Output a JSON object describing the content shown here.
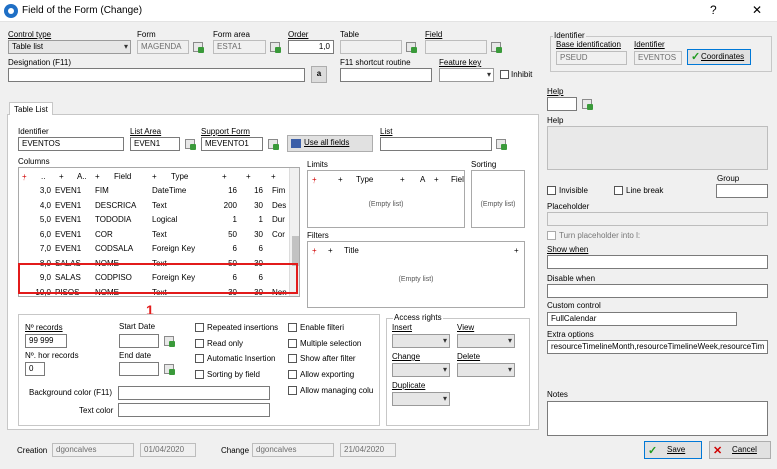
{
  "window": {
    "title": "Field of the Form (Change)",
    "help_glyph": "?",
    "close_glyph": "✕"
  },
  "top": {
    "control_type_label": "Control type",
    "control_type_value": "Table list",
    "form_label": "Form",
    "form_value": "MAGENDA",
    "form_area_label": "Form area",
    "form_area_value": "ESTA1",
    "order_label": "Order",
    "order_value": "1,0",
    "table_label": "Table",
    "field_label": "Field",
    "designation_label": "Designation (F11)",
    "designation_btn": "a",
    "f11_label": "F11 shortcut routine",
    "feature_key_label": "Feature key",
    "inhibit_label": "Inhibit"
  },
  "identifier_box": {
    "title": "Identifier",
    "base_label": "Base identification",
    "base_value": "PSEUD",
    "identifier_label": "Identifier",
    "identifier_value": "EVENTOS",
    "coordinates_btn": "Coordinates"
  },
  "tab": {
    "label": "Table List"
  },
  "table_list": {
    "identifier_label": "Identifier",
    "identifier_value": "EVENTOS",
    "list_area_label": "List Area",
    "list_area_value": "EVEN1",
    "support_form_label": "Support Form",
    "support_form_value": "MEVENTO1",
    "use_all_fields_btn": "Use all fields",
    "list_label": "List",
    "columns_label": "Columns",
    "columns_headers": [
      "..",
      "A..",
      "Field",
      "Type"
    ],
    "columns_rows": [
      [
        "3,0",
        "EVEN1",
        "FIM",
        "DateTime",
        "16",
        "16",
        "Fim"
      ],
      [
        "4,0",
        "EVEN1",
        "DESCRICA",
        "Text",
        "200",
        "30",
        "Des"
      ],
      [
        "5,0",
        "EVEN1",
        "TODODIA",
        "Logical",
        "1",
        "1",
        "Dur"
      ],
      [
        "6,0",
        "EVEN1",
        "COR",
        "Text",
        "50",
        "30",
        "Cor"
      ],
      [
        "7,0",
        "EVEN1",
        "CODSALA",
        "Foreign Key",
        "6",
        "6",
        ""
      ],
      [
        "8,0",
        "SALAS",
        "NOME",
        "Text",
        "50",
        "30",
        ""
      ],
      [
        "9,0",
        "SALAS",
        "CODPISO",
        "Foreign Key",
        "6",
        "6",
        ""
      ],
      [
        "10,0",
        "PISOS",
        "NOME",
        "Text",
        "30",
        "30",
        "Non"
      ]
    ],
    "highlight_label": "1",
    "limits_label": "Limits",
    "limits_headers": [
      "Type",
      "A",
      "Fiel"
    ],
    "limits_empty": "(Empty list)",
    "sorting_label": "Sorting",
    "sorting_empty": "(Empty list)",
    "filters_label": "Filters",
    "filters_headers": [
      "Title"
    ],
    "filters_empty": "(Empty list)"
  },
  "bottom": {
    "n_records_label": "Nº records",
    "n_records_value": "99 999",
    "n_hor_label": "Nº. hor records",
    "n_hor_value": "0",
    "start_date_label": "Start Date",
    "end_date_label": "End date",
    "checks_col1": [
      "Repeated insertions",
      "Read only",
      "Automatic Insertion",
      "Sorting by field"
    ],
    "checks_col2": [
      "Enable filteri",
      "Multiple selection",
      "Show after filter",
      "Allow exporting",
      "Allow managing colu"
    ],
    "bg_color_label": "Background color (F11)",
    "text_color_label": "Text color",
    "access_rights_label": "Access rights",
    "insert_label": "Insert",
    "view_label": "View",
    "change_label": "Change",
    "delete_label": "Delete",
    "duplicate_label": "Duplicate"
  },
  "right": {
    "help1_label": "Help",
    "help2_label": "Help",
    "invisible_label": "Invisible",
    "line_break_label": "Line break",
    "group_label": "Group",
    "placeholder_label": "Placeholder",
    "turn_placeholder_label": "Turn placeholder into l:",
    "show_when_label": "Show when",
    "disable_when_label": "Disable when",
    "custom_control_label": "Custom control",
    "custom_control_value": "FullCalendar",
    "extra_options_label": "Extra options",
    "extra_options_value": "resourceTimelineMonth,resourceTimelineWeek,resourceTim",
    "notes_label": "Notes"
  },
  "footer": {
    "creation_label": "Creation",
    "creation_user": "dgoncalves",
    "creation_date": "01/04/2020",
    "change_label": "Change",
    "change_user": "dgoncalves",
    "change_date": "21/04/2020",
    "save_btn": "Save",
    "cancel_btn": "Cancel"
  },
  "colors": {
    "highlight": "#e21b1b",
    "accent_green": "#1f9a1f",
    "cancel_red": "#d00000"
  }
}
